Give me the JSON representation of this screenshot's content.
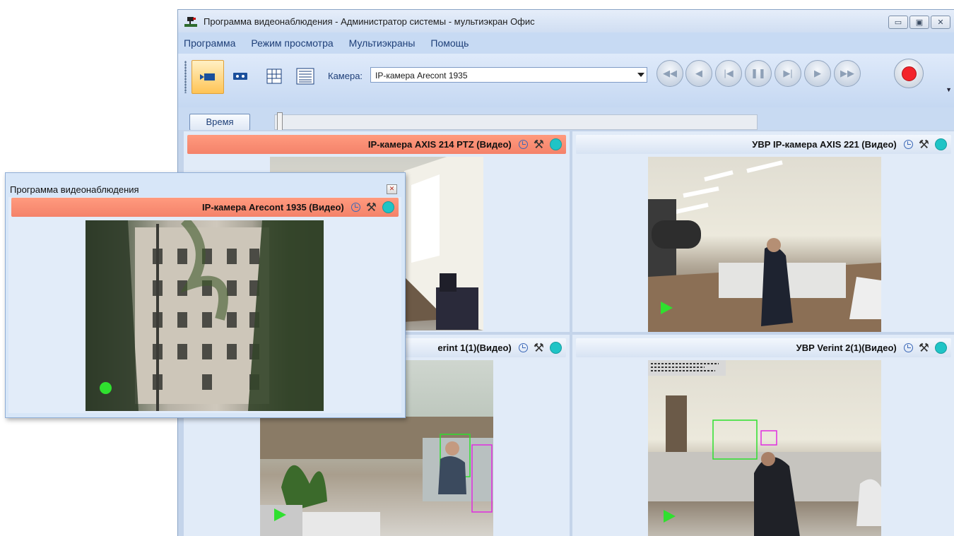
{
  "window": {
    "title": "Программа видеонаблюдения - Администратор системы - мультиэкран Офис",
    "controls": [
      "▭",
      "▣",
      "✕"
    ]
  },
  "menu": [
    "Программа",
    "Режим просмотра",
    "Мультиэкраны",
    "Помощь"
  ],
  "toolbar": {
    "camera_label": "Камера:",
    "camera_value": "IP-камера Arecont 1935",
    "nav_icons": [
      "rewind-fast",
      "rewind",
      "skip-start",
      "pause",
      "skip-end",
      "play",
      "fast-forward"
    ],
    "nav_glyphs": [
      "◀◀",
      "◀",
      "|◀",
      "❚❚",
      "▶|",
      "▶",
      "▶▶"
    ]
  },
  "timebar": {
    "button_label": "Время"
  },
  "cells": [
    {
      "title": "IP-камера AXIS 214 PTZ (Видео)",
      "highlighted": true
    },
    {
      "title": "УВР IP-камера AXIS 221 (Видео)",
      "highlighted": false
    },
    {
      "title": "erint 1(1)(Видео)",
      "highlighted": false
    },
    {
      "title": "УВР Verint 2(1)(Видео)",
      "highlighted": false
    }
  ],
  "floating": {
    "title": "Программа видеонаблюдения",
    "close_glyph": "✕",
    "cell_title": "IP-камера Arecont 1935 (Видео)"
  },
  "colors": {
    "highlight_header": "#f4826a",
    "status": "#1fc4c6",
    "record": "#f3242b",
    "play_marker": "#2fe02f"
  }
}
